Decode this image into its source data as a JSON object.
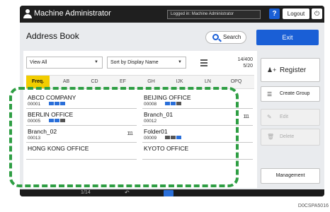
{
  "topbar": {
    "title": "Machine Administrator",
    "logged_in": "Logged in: Machine Administrator",
    "help_label": "?",
    "logout_label": "Logout"
  },
  "header": {
    "title": "Address Book",
    "search_label": "Search",
    "exit_label": "Exit"
  },
  "filters": {
    "view": "View All",
    "sort": "Sort by Display Name",
    "count_line1": "14/400",
    "count_line2": "5/20"
  },
  "tabs": [
    {
      "label": "Freq."
    },
    {
      "label": "AB"
    },
    {
      "label": "CD"
    },
    {
      "label": "EF"
    },
    {
      "label": "GH"
    },
    {
      "label": "IJK"
    },
    {
      "label": "LN"
    },
    {
      "label": "OPQ"
    }
  ],
  "entries": [
    {
      "name": "ABCD COMPANY",
      "number": "00001",
      "group": ""
    },
    {
      "name": "BEIJING OFFICE",
      "number": "00008",
      "group": ""
    },
    {
      "name": "BERLIN OFFICE",
      "number": "00005",
      "group": ""
    },
    {
      "name": "Branch_01",
      "number": "00012",
      "group": "111"
    },
    {
      "name": "Branch_02",
      "number": "00013",
      "group": "111"
    },
    {
      "name": "Folder01",
      "number": "00009",
      "group": ""
    },
    {
      "name": "HONG KONG OFFICE",
      "number": "",
      "group": ""
    },
    {
      "name": "KYOTO OFFICE",
      "number": "",
      "group": ""
    }
  ],
  "sidebar": {
    "register_label": "Register",
    "create_group_label": "Create Group",
    "edit_label": "Edit",
    "delete_label": "Delete",
    "management_label": "Management"
  },
  "bottombar": {
    "page_label": "1/14"
  },
  "figure_code": "D0CSPA5016",
  "colors": {
    "accent": "#1a5fd6",
    "active_tab": "#f2cd00",
    "highlight": "#2e9e43"
  }
}
